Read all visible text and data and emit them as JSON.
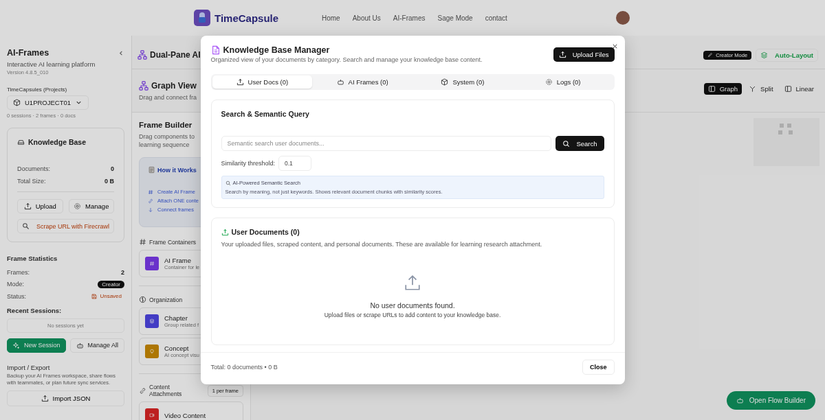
{
  "nav": {
    "brand": "TimeCapsule",
    "links": [
      "Home",
      "About Us",
      "AI-Frames",
      "Sage Mode",
      "contact"
    ]
  },
  "sidebar": {
    "title": "AI-Frames",
    "subtitle": "Interactive AI learning platform",
    "version": "Version 4.8.5_010",
    "projects_label": "TimeCapsules (Projects)",
    "project": "U1PROJECT01",
    "project_summary": "0 sessions · 2 frames · 0 docs",
    "knowledge_base": {
      "title": "Knowledge Base",
      "stats": [
        {
          "label": "Documents:",
          "value": "0"
        },
        {
          "label": "Total Size:",
          "value": "0 B"
        }
      ],
      "buttons": [
        {
          "label": "Upload",
          "kind": "upload"
        },
        {
          "label": "Manage",
          "kind": "manage"
        }
      ],
      "scrape_button": "Scrape URL with Firecrawl"
    },
    "frame_statistics": {
      "title": "Frame Statistics",
      "rows": [
        {
          "label": "Frames:",
          "value": "2",
          "kind": "plain"
        },
        {
          "label": "Mode:",
          "value": "Creator",
          "kind": "badge"
        },
        {
          "label": "Status:",
          "value": "Unsaved",
          "kind": "warning"
        }
      ]
    },
    "recent_sessions": {
      "title": "Recent Sessions:",
      "empty": "No sessions yet"
    },
    "session_buttons": [
      {
        "label": "New Session",
        "kind": "primary"
      },
      {
        "label": "Manage All",
        "kind": "secondary"
      }
    ],
    "import_export": {
      "title": "Import / Export",
      "description": "Backup your AI Frames workspace, share flows with teammates, or plan future sync services.",
      "button": "Import JSON"
    }
  },
  "workspace": {
    "title": "Dual-Pane AI",
    "creator_mode": "Creator Mode",
    "auto_layout": "Auto-Layout",
    "view_title": "Graph View",
    "view_subtitle": "Drag and connect fra",
    "view_modes": [
      {
        "label": "Graph",
        "selected": true
      },
      {
        "label": "Split",
        "selected": false
      },
      {
        "label": "Linear",
        "selected": false
      }
    ],
    "open_flow_builder": "Open Flow Builder"
  },
  "palette": {
    "title": "Frame Builder",
    "subtitle_lines": [
      "Drag components to",
      "learning sequence"
    ],
    "how_it_works": {
      "title": "How it Works",
      "steps": [
        {
          "text": "Create AI Frame",
          "kind": "hash"
        },
        {
          "text": "Attach ONE conte",
          "kind": "link"
        },
        {
          "text": "Connect frames",
          "kind": "arrow"
        }
      ]
    },
    "groups": [
      {
        "title": "Frame Containers",
        "kind": "hash",
        "items": [
          {
            "name": "AI Frame",
            "description": "Container for le",
            "kind": "hash"
          }
        ]
      },
      {
        "title": "Organization",
        "kind": "brain",
        "items": [
          {
            "name": "Chapter",
            "description": "Group related f",
            "kind": "layers"
          },
          {
            "name": "Concept",
            "description": "AI concept visu",
            "kind": "bulb"
          }
        ]
      },
      {
        "title": "Content Attachments",
        "kind": "link",
        "badge": "1 per frame",
        "items": [
          {
            "name": "Video Content",
            "kind": "video"
          }
        ]
      }
    ]
  },
  "modal": {
    "title": "Knowledge Base Manager",
    "subtitle": "Organized view of your documents by category. Search and manage your knowledge base content.",
    "upload_button": "Upload Files",
    "tabs": [
      {
        "label": "User Docs (0)",
        "kind": "upload",
        "selected": true
      },
      {
        "label": "AI Frames (0)",
        "kind": "bot",
        "selected": false
      },
      {
        "label": "System (0)",
        "kind": "box",
        "selected": false
      },
      {
        "label": "Logs (0)",
        "kind": "gear",
        "selected": false
      }
    ],
    "search": {
      "title": "Search & Semantic Query",
      "placeholder": "Semantic search user documents...",
      "button": "Search",
      "threshold_label": "Similarity threshold:",
      "threshold_value": "0.1",
      "info_title": "AI-Powered Semantic Search",
      "info_text": "Search by meaning, not just keywords. Shows relevant document chunks with similarity scores."
    },
    "documents": {
      "title": "User Documents (0)",
      "description": "Your uploaded files, scraped content, and personal documents. These are available for learning research attachment.",
      "empty_title": "No user documents found.",
      "empty_text": "Upload files or scrape URLs to add content to your knowledge base."
    },
    "footer": {
      "total": "Total: 0 documents • 0 B",
      "close_button": "Close"
    }
  }
}
